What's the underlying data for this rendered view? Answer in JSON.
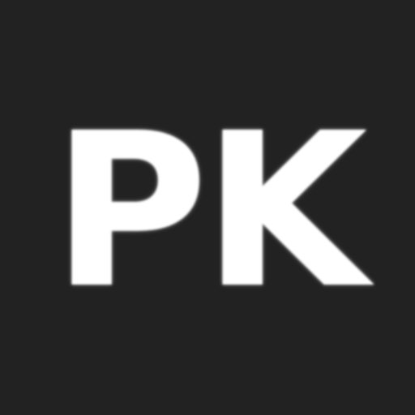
{
  "avatar": {
    "initials": "PK"
  },
  "colors": {
    "background": "#222222",
    "text": "#ffffff"
  }
}
